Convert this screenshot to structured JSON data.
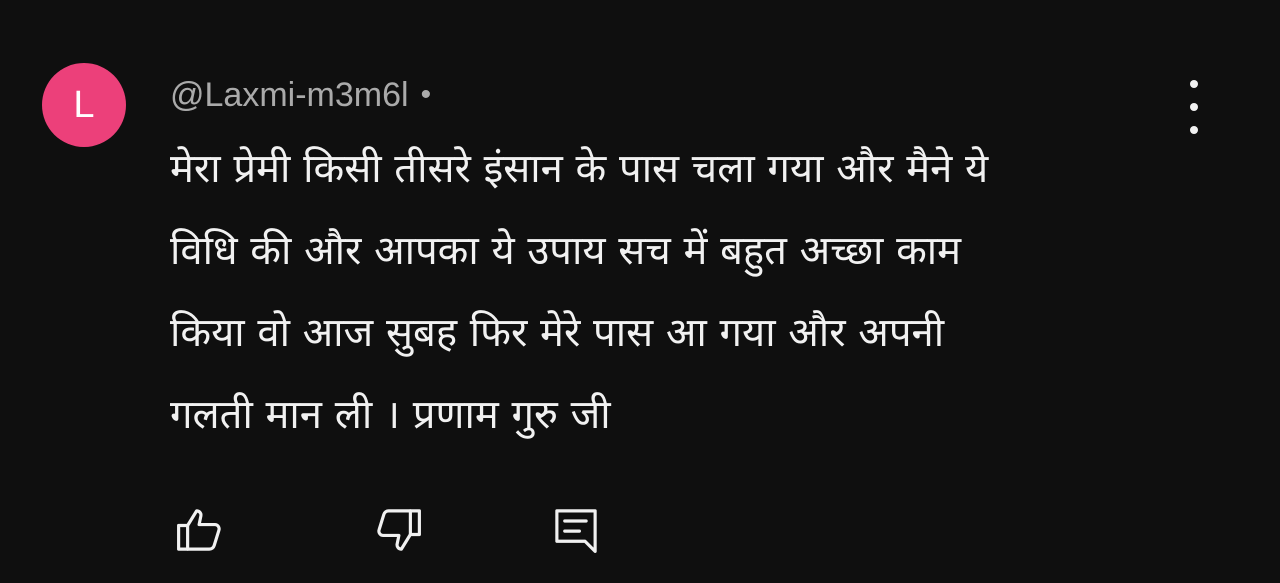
{
  "comment": {
    "avatar": {
      "initial": "L",
      "color": "#ec407a"
    },
    "author": "@Laxmi-m3m6l",
    "separator": "•",
    "text_lines": [
      "मेरा प्रेमी किसी तीसरे इंसान के पास चला गया और मैने ये",
      "विधि की और आपका ये उपाय सच में बहुत अच्छा काम",
      "किया वो आज सुबह फिर मेरे पास आ गया और अपनी",
      "गलती मान ली । प्रणाम गुरु जी"
    ],
    "actions": {
      "like_icon": "thumbs-up-icon",
      "dislike_icon": "thumbs-down-icon",
      "reply_icon": "reply-comment-icon"
    },
    "more_menu_icon": "more-vertical-icon"
  },
  "theme": {
    "background": "#0f0f0f",
    "primary_text": "#f1f1f1",
    "secondary_text": "#aaaaaa"
  }
}
